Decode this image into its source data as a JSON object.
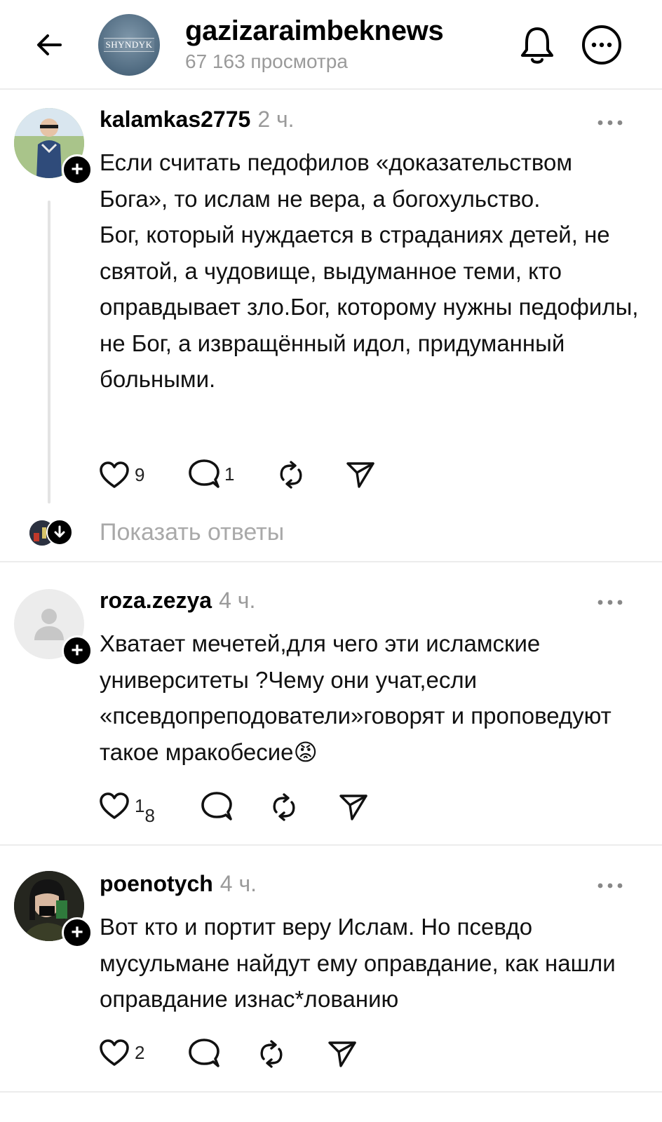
{
  "header": {
    "channel_name": "gazizaraimbeknews",
    "views": "67 163 просмотра",
    "logo_text": "SHYNDYK",
    "back_icon": "arrow-left-icon",
    "bell_icon": "bell-icon",
    "more_icon": "more-circle-icon"
  },
  "comments": [
    {
      "username": "kalamkas2775",
      "time": "2 ч.",
      "text": "Если считать педофилов «доказательством Бога», то ислам не вера, а богохульство.\nБог, который нуждается в страданиях детей, не святой, а чудовище, выдуманное теми, кто оправдывает зло.Бог, которому нужны педофилы, не Бог, а извращённый идол, придуманный больными.",
      "likes": "9",
      "replies": "1",
      "show_replies": "Показать ответы"
    },
    {
      "username": "roza.zezya",
      "time": "4 ч.",
      "text": "Хватает мечетей,для чего эти исламские университеты ?Чему они учат,если «псевдопреподователи»говорят и проповедуют такое мракобесие😡",
      "likes_main": "1",
      "likes_sub": "8"
    },
    {
      "username": "poenotych",
      "time": "4 ч.",
      "text": "Вот кто и портит веру Ислам. Но псевдо мусульмане найдут ему оправдание, как нашли оправдание изнас*лованию",
      "likes": "2"
    }
  ]
}
